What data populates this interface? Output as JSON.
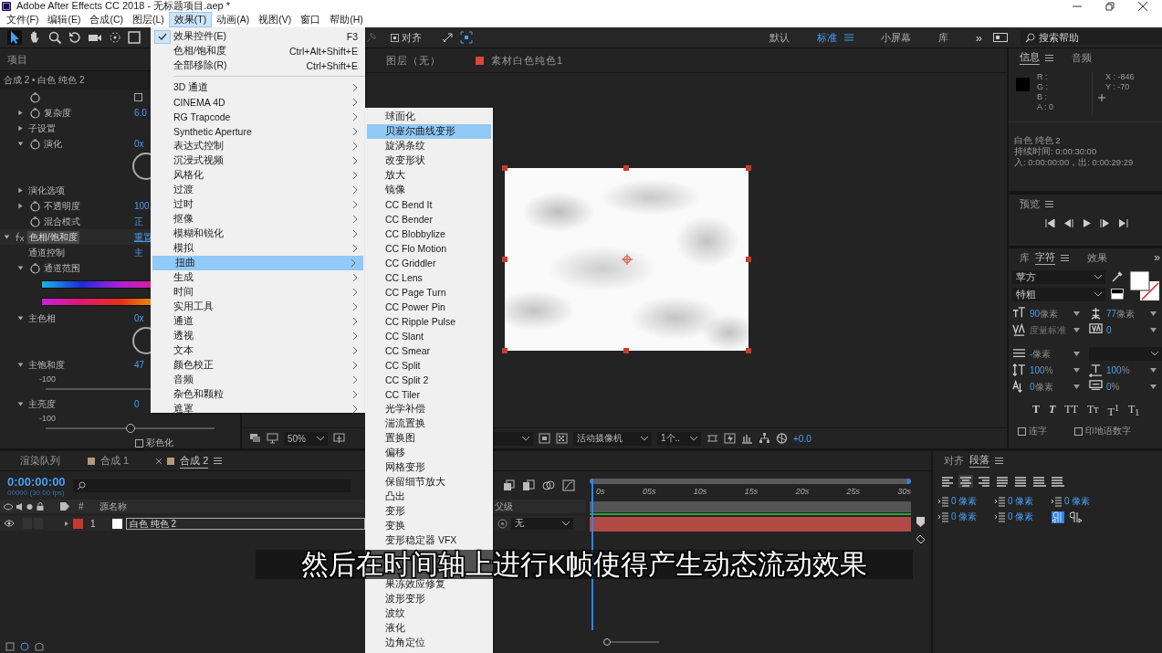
{
  "window": {
    "title": "Adobe After Effects CC 2018 - 无标题项目.aep *"
  },
  "menu_bar": [
    {
      "label": "文件(F)",
      "selected": false
    },
    {
      "label": "编辑(E)",
      "selected": false
    },
    {
      "label": "合成(C)",
      "selected": false
    },
    {
      "label": "图层(L)",
      "selected": false
    },
    {
      "label": "效果(T)",
      "selected": true
    },
    {
      "label": "动画(A)",
      "selected": false
    },
    {
      "label": "视图(V)",
      "selected": false
    },
    {
      "label": "窗口",
      "selected": false
    },
    {
      "label": "帮助(H)",
      "selected": false
    }
  ],
  "toolbar": {
    "align_checkbox": {
      "label": "对齐",
      "checked": true
    },
    "workspaces": [
      {
        "label": "默认",
        "selected": false
      },
      {
        "label": "标准",
        "selected": true
      },
      {
        "label": "小屏幕",
        "selected": false
      },
      {
        "label": "库",
        "selected": false
      }
    ],
    "overflow": "»",
    "search": {
      "placeholder": "搜索帮助"
    }
  },
  "effect_controls": {
    "tab": "项目",
    "header": "合成 2 • 白色 纯色 2",
    "rows": [
      {
        "kind": "toggle",
        "stopwatch": true,
        "checked": false
      },
      {
        "kind": "prop",
        "expanded": false,
        "stopwatch": true,
        "label": "复杂度",
        "value": "6.0"
      },
      {
        "kind": "prop",
        "expanded": false,
        "stopwatch": false,
        "label": "子设置"
      },
      {
        "kind": "prop",
        "expanded": true,
        "stopwatch": true,
        "label": "演化",
        "value": "0x"
      },
      {
        "kind": "dial"
      },
      {
        "kind": "prop",
        "expanded": false,
        "stopwatch": false,
        "label": "演化选项"
      },
      {
        "kind": "prop",
        "expanded": false,
        "stopwatch": true,
        "label": "不透明度",
        "value": "100."
      },
      {
        "kind": "prop",
        "stopwatch": true,
        "label": "混合模式",
        "value": "正"
      },
      {
        "kind": "effect",
        "expanded": true,
        "label": "色相/饱和度",
        "value": "重置"
      },
      {
        "kind": "prop",
        "stopwatch": false,
        "label": "通道控制",
        "value": "主"
      },
      {
        "kind": "prop",
        "expanded": true,
        "stopwatch": true,
        "label": "通道范围"
      },
      {
        "kind": "input-spectrum"
      },
      {
        "kind": "output-spectrum"
      },
      {
        "kind": "prop",
        "expanded": true,
        "stopwatch": false,
        "label": "主色相",
        "value": "0x"
      },
      {
        "kind": "dial"
      },
      {
        "kind": "prop",
        "expanded": true,
        "stopwatch": false,
        "label": "主饱和度",
        "value": "47"
      },
      {
        "kind": "slider",
        "min": "-100"
      },
      {
        "kind": "prop",
        "expanded": true,
        "stopwatch": false,
        "label": "主亮度",
        "value": "0"
      },
      {
        "kind": "slider",
        "min": "-100",
        "level": 0.5
      },
      {
        "kind": "checkbox",
        "label": "彩色化",
        "checked": false
      }
    ]
  },
  "effects_menu": {
    "items": [
      {
        "label": "效果控件(E)",
        "shortcut": "F3",
        "checked": true
      },
      {
        "label": "色相/饱和度",
        "shortcut": "Ctrl+Alt+Shift+E",
        "checked": false
      },
      {
        "label": "全部移除(R)",
        "shortcut": "Ctrl+Shift+E",
        "checked": false
      }
    ],
    "categories": [
      {
        "label": "3D 通道",
        "selected": false
      },
      {
        "label": "CINEMA 4D",
        "selected": false
      },
      {
        "label": "RG Trapcode",
        "selected": false
      },
      {
        "label": "Synthetic Aperture",
        "selected": false
      },
      {
        "label": "表达式控制",
        "selected": false
      },
      {
        "label": "沉浸式视频",
        "selected": false
      },
      {
        "label": "风格化",
        "selected": false
      },
      {
        "label": "过渡",
        "selected": false
      },
      {
        "label": "过时",
        "selected": false
      },
      {
        "label": "抠像",
        "selected": false
      },
      {
        "label": "模糊和锐化",
        "selected": false
      },
      {
        "label": "模拟",
        "selected": false
      },
      {
        "label": "扭曲",
        "selected": true
      },
      {
        "label": "生成",
        "selected": false
      },
      {
        "label": "时间",
        "selected": false
      },
      {
        "label": "实用工具",
        "selected": false
      },
      {
        "label": "通道",
        "selected": false
      },
      {
        "label": "透视",
        "selected": false
      },
      {
        "label": "文本",
        "selected": false
      },
      {
        "label": "颜色校正",
        "selected": false
      },
      {
        "label": "音频",
        "selected": false
      },
      {
        "label": "杂色和颗粒",
        "selected": false
      },
      {
        "label": "遮罩",
        "selected": false
      }
    ]
  },
  "distort_submenu": {
    "items": [
      {
        "label": "球面化",
        "selected": false
      },
      {
        "label": "贝塞尔曲线变形",
        "selected": true
      },
      {
        "label": "旋涡条纹",
        "selected": false
      },
      {
        "label": "改变形状",
        "selected": false
      },
      {
        "label": "放大",
        "selected": false
      },
      {
        "label": "镜像",
        "selected": false
      },
      {
        "label": "CC Bend It",
        "selected": false
      },
      {
        "label": "CC Bender",
        "selected": false
      },
      {
        "label": "CC Blobbylize",
        "selected": false
      },
      {
        "label": "CC Flo Motion",
        "selected": false
      },
      {
        "label": "CC Griddler",
        "selected": false
      },
      {
        "label": "CC Lens",
        "selected": false
      },
      {
        "label": "CC Page Turn",
        "selected": false
      },
      {
        "label": "CC Power Pin",
        "selected": false
      },
      {
        "label": "CC Ripple Pulse",
        "selected": false
      },
      {
        "label": "CC Slant",
        "selected": false
      },
      {
        "label": "CC Smear",
        "selected": false
      },
      {
        "label": "CC Split",
        "selected": false
      },
      {
        "label": "CC Split 2",
        "selected": false
      },
      {
        "label": "CC Tiler",
        "selected": false
      },
      {
        "label": "光学补偿",
        "selected": false
      },
      {
        "label": "湍流置换",
        "selected": false
      },
      {
        "label": "置换图",
        "selected": false
      },
      {
        "label": "偏移",
        "selected": false
      },
      {
        "label": "网格变形",
        "selected": false
      },
      {
        "label": "保留细节放大",
        "selected": false
      },
      {
        "label": "凸出",
        "selected": false
      },
      {
        "label": "变形",
        "selected": false
      },
      {
        "label": "变换",
        "selected": false
      },
      {
        "label": "变形稳定器 VFX",
        "selected": false
      }
    ],
    "items_below_caption": [
      {
        "label": "果冻效应修复",
        "selected": false
      },
      {
        "label": "波形变形",
        "selected": false
      },
      {
        "label": "波纹",
        "selected": false
      },
      {
        "label": "液化",
        "selected": false
      },
      {
        "label": "边角定位",
        "selected": false
      }
    ]
  },
  "viewer": {
    "tabs": [
      {
        "label": "图层（无）"
      },
      {
        "label": "素材白色纯色1",
        "color": "#d9453a"
      }
    ],
    "zoom": "50%",
    "camera": "活动摄像机",
    "views": "1个..",
    "exposure": "+0.0"
  },
  "info_panel": {
    "tabs": [
      {
        "label": "信息",
        "selected": true
      },
      {
        "label": "音频",
        "selected": false
      }
    ],
    "channels": [
      "R :",
      "G :",
      "B :",
      "A : 0"
    ],
    "x": "X : -846",
    "y": "Y : -70",
    "lines": [
      "白色 纯色 2",
      "持续时间: 0:00:30:00",
      "入: 0:00:00:00，出: 0:00:29:29"
    ]
  },
  "preview_panel": {
    "title": "预览"
  },
  "character_panel": {
    "tabs": [
      {
        "label": "库",
        "selected": false
      },
      {
        "label": "字符",
        "selected": true
      },
      {
        "label": "效果",
        "selected": false
      }
    ],
    "overflow": "»",
    "font": "苹方",
    "style": "特粗",
    "fields": [
      {
        "kind": "size",
        "value": "90",
        "unit": "像素"
      },
      {
        "kind": "leading",
        "value": "77",
        "unit": "像素"
      },
      {
        "kind": "kerning",
        "value": "度量标准",
        "disabled": true
      },
      {
        "kind": "tracking",
        "value": "0"
      },
      {
        "kind": "stroke",
        "value": "-",
        "unit": "像素"
      },
      {
        "kind": "empty"
      },
      {
        "kind": "vscale",
        "value": "100",
        "unit": "%"
      },
      {
        "kind": "hscale",
        "value": "100",
        "unit": "%"
      },
      {
        "kind": "baseline",
        "value": "0",
        "unit": "像素"
      },
      {
        "kind": "tsume",
        "value": "0",
        "unit": "%"
      }
    ],
    "styles": [
      {
        "kind": "bold",
        "label": "T"
      },
      {
        "kind": "italic",
        "label": "T"
      },
      {
        "kind": "plain",
        "label": "TT"
      },
      {
        "kind": "plain",
        "label": "Tᴛ"
      },
      {
        "kind": "plain",
        "label": "T$^{1}$"
      },
      {
        "kind": "plain",
        "label": "T$_{1}$"
      }
    ],
    "checkboxes": [
      {
        "label": "连字",
        "checked": false
      },
      {
        "label": "印地语数字",
        "checked": false
      }
    ]
  },
  "timeline": {
    "tabs": [
      {
        "label": "渲染队列",
        "kind": "queue",
        "selected": false
      },
      {
        "label": "合成 1",
        "kind": "comp",
        "selected": false
      },
      {
        "label": "合成 2",
        "kind": "comp",
        "selected": true
      }
    ],
    "time": "0:00:00:00",
    "fps": "00000 (30.00 fps)",
    "columns": {
      "number": "#",
      "name": "源名称",
      "parent": "父级"
    },
    "layer": {
      "solo": false,
      "locked": false,
      "number": "1",
      "name": "白色 纯色 2",
      "parent": "无",
      "color": "#c8382e"
    },
    "ruler": [
      "0s",
      "05s",
      "10s",
      "15s",
      "20s",
      "25s",
      "30s"
    ],
    "zoom": {
      "level": 0.05
    }
  },
  "paragraph_panel": {
    "tabs": [
      {
        "label": "对齐",
        "selected": false
      },
      {
        "label": "段落",
        "selected": true
      }
    ],
    "alignments": [
      {
        "selected": false
      },
      {
        "selected": true
      },
      {
        "selected": false
      },
      {
        "selected": false
      },
      {
        "selected": false
      },
      {
        "selected": false
      },
      {
        "selected": false
      }
    ],
    "fields": [
      "0 像素",
      "0 像素",
      "0 像素",
      "0 像素",
      "0 像素"
    ],
    "directions": [
      {
        "selected": true
      },
      {
        "selected": false
      }
    ]
  },
  "caption": "然后在时间轴上进行K帧使得产生动态流动效果"
}
